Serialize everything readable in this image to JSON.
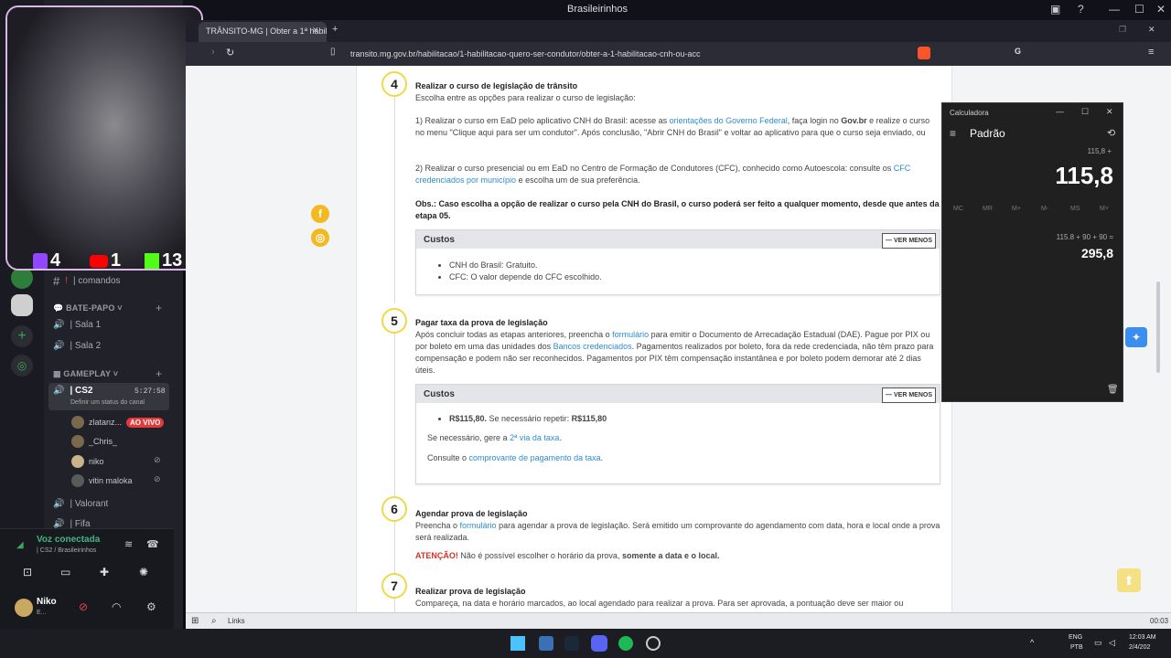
{
  "window": {
    "title": "Brasileirinhos"
  },
  "browser": {
    "tab_title": "TRÂNSITO-MG | Obter a 1ª habil",
    "url": "transito.mg.gov.br/habilitacao/1-habilitacao-quero-ser-condutor/obter-a-1-habilitacao-cnh-ou-acc"
  },
  "stream": {
    "twitch_count": "4",
    "youtube_count": "1",
    "kick_count": "13"
  },
  "discord": {
    "channel_comandos": "| comandos",
    "cat_batepapo": "BATE-PAPO",
    "sala1": "| Sala 1",
    "sala2": "| Sala 2",
    "cat_gameplay": "GAMEPLAY",
    "cs2": "| CS2",
    "cs2_timer": "5:27:58",
    "cs2_status": "Definir um status do canal",
    "users": [
      {
        "name": "zlatanz...",
        "badge": "AO VIVO"
      },
      {
        "name": "_Chris_"
      },
      {
        "name": "niko"
      },
      {
        "name": "vitin maloka"
      }
    ],
    "valorant": "| Valorant",
    "fifa": "| Fifa",
    "voice_status": "Voz conectada",
    "voice_channel": "| CS2 / Brasileirinhos",
    "user_name": "Niko",
    "user_sub": "E..."
  },
  "page": {
    "step4": {
      "num": "4",
      "title": "Realizar o curso de legislação de trânsito",
      "intro": "Escolha entre as opções para realizar o curso de legislação:",
      "opt1_a": "1) Realizar o curso em EaD pelo aplicativo CNH do Brasil: acesse as ",
      "opt1_link": "orientações do Governo Federal",
      "opt1_b": ", faça login no ",
      "opt1_bold": "Gov.br",
      "opt1_c": " e realize o curso no menu \"Clique aqui para ser um condutor\". Após conclusão, \"Abrir CNH do Brasil\" e voltar ao aplicativo para que o curso seja enviado, ou",
      "opt2_a": "2) Realizar o curso presencial ou em EaD no Centro de Formação de Condutores (CFC), conhecido como Autoescola: consulte os ",
      "opt2_link": "CFC credenciados por município",
      "opt2_b": " e escolha um de sua preferência.",
      "obs": "Obs.:  Caso escolha a opção de realizar o curso pela CNH do Brasil, o curso poderá ser feito a qualquer momento, desde que antes da etapa 05.",
      "box_title": "Custos",
      "ver_menos": "VER MENOS",
      "cost1": "CNH do Brasil: Gratuito.",
      "cost2": "CFC: O valor depende do CFC escolhido."
    },
    "step5": {
      "num": "5",
      "title": "Pagar taxa da prova de legislação",
      "text_a": "Após concluir todas as etapas anteriores, preencha o ",
      "text_link1": "formulário",
      "text_b": " para emitir o Documento de Arrecadação Estadual (DAE). Pague por PIX ou por boleto em uma das unidades dos ",
      "text_link2": "Bancos credenciados",
      "text_c": ". Pagamentos realizados por boleto, fora da rede credenciada, não têm prazo para compensação e podem não ser reconhecidos.  Pagamentos por PIX têm compensação instantânea e por boleto podem demorar até 2 dias úteis.",
      "box_title": "Custos",
      "ver_menos": "VER MENOS",
      "price": "R$115,80.",
      "price_mid": " Se necessário repetir: ",
      "price_repeat": "R$115,80",
      "second_a": "Se necessário, gere a ",
      "second_link": "2ª via da taxa",
      "second_b": ".",
      "consult_a": "Consulte o ",
      "consult_link": "comprovante de pagamento da taxa",
      "consult_b": "."
    },
    "step6": {
      "num": "6",
      "title": "Agendar prova de legislação",
      "text_a": "Preencha o ",
      "text_link": "formulário",
      "text_b": " para agendar a prova de legislação. Será emitido um comprovante do agendamento com data, hora e local onde a prova será realizada.",
      "warn": "ATENÇÃO!",
      "warn_text": " Não é possível escolher o horário da prova, ",
      "warn_bold": "somente a data e o local."
    },
    "step7": {
      "num": "7",
      "title": "Realizar prova de legislação",
      "text": "Compareça, na data e horário marcados, ao local agendado para realizar a prova. Para ser aprovada, a pontuação deve ser maior ou"
    }
  },
  "calculator": {
    "app": "Calculadora",
    "mode": "Padrão",
    "small": "115,8 +",
    "display": "115,8",
    "mem": [
      "MC",
      "MR",
      "M+",
      "M-",
      "MS",
      "M˅"
    ],
    "hist_expr": "115.8  +  90  +  90 =",
    "hist_result": "295,8"
  },
  "taskbar": {
    "links": "Links",
    "lang1": "ENG",
    "lang2": "PTB",
    "time": "12:03 AM",
    "date": "2/4/202",
    "inner_time": "00:03"
  }
}
